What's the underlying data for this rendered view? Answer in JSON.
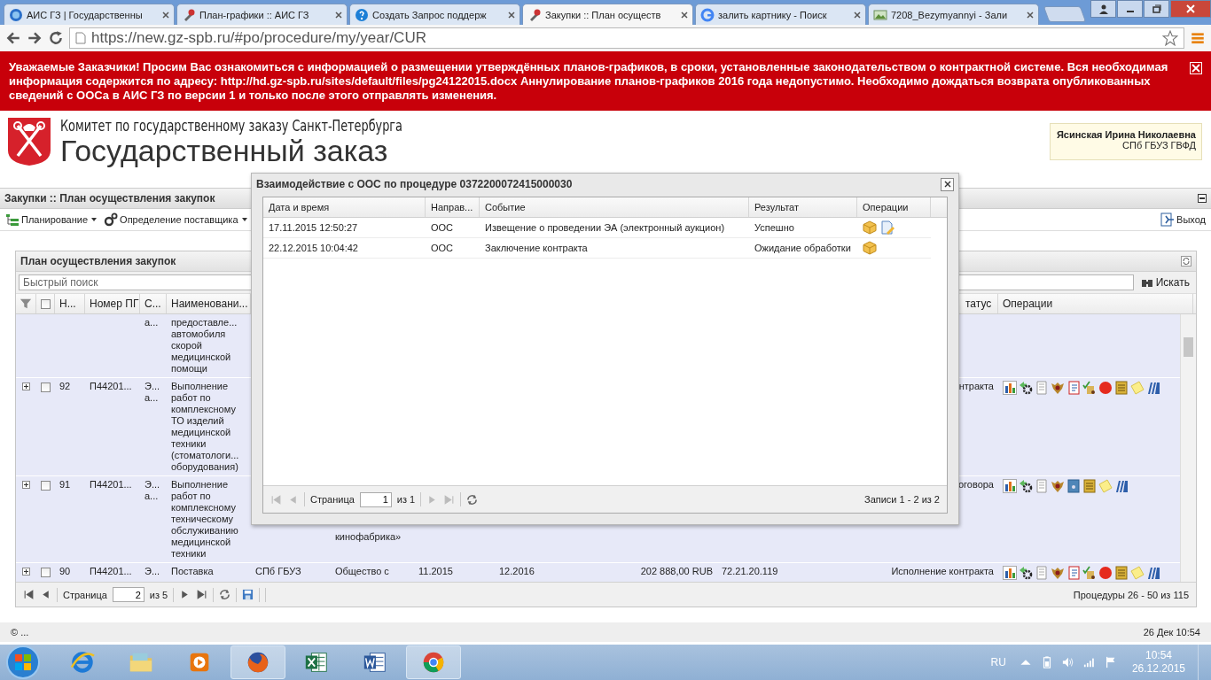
{
  "browser": {
    "tabs": [
      {
        "kind": "globe",
        "title": "АИС ГЗ | Государственны",
        "selected": false
      },
      {
        "kind": "wrench",
        "title": "План-графики :: АИС ГЗ",
        "selected": false
      },
      {
        "kind": "help",
        "title": "Создать Запрос поддерж",
        "selected": false
      },
      {
        "kind": "wrench",
        "title": "Закупки :: План осуществ",
        "selected": true
      },
      {
        "kind": "search",
        "title": "залить картнику - Поиск",
        "selected": false
      },
      {
        "kind": "image",
        "title": "7208_Bezymyannyi - Зали",
        "selected": false
      }
    ],
    "address": "https://new.gz-spb.ru/#po/procedure/my/year/CUR"
  },
  "banner": {
    "text": "Уважаемые Заказчики! Просим Вас ознакомиться с информацией о размещении утверждённых планов-графиков, в сроки, установленные законодательством о контрактной системе. Вся необходимая информация содержится по адресу: http://hd.gz-spb.ru/sites/default/files/pg24122015.docx Аннулирование планов-графиков 2016 года недопустимо. Необходимо дождаться возврата опубликованных сведений с ООСа в АИС ГЗ по версии 1 и только после этого отправлять изменения."
  },
  "header": {
    "org": "Комитет по государственному заказу Санкт-Петербурга",
    "title": "Государственный заказ",
    "user": {
      "name": "Ясинская Ирина Николаевна",
      "org": "СПб ГБУЗ ГВФД"
    }
  },
  "panel": {
    "title": "Закупки :: План осуществления закупок",
    "toolbar": [
      {
        "kind": "tree",
        "label": "Планирование"
      },
      {
        "kind": "gears",
        "label": "Определение поставщика"
      }
    ],
    "exit": "Выход"
  },
  "grid": {
    "title": "План осуществления закупок",
    "search": {
      "placeholder": "Быстрый поиск",
      "button": "Искать"
    },
    "select_all": {
      "checked": false
    },
    "columns": [
      "Н...",
      "Номер ПГ",
      "С...",
      "Наименовани...",
      "татус",
      "Операции"
    ],
    "rows": [
      {
        "method": "а...",
        "name": "предоставле... автомобиля скорой медицинской помощи"
      },
      {
        "checked": false,
        "n": "92",
        "pg": "П44201...",
        "method": "Э... а...",
        "name": "Выполнение работ по комплексному ТО изделий медицинской техники (стоматологи... оборудования)",
        "status": "нтракта",
        "operations": [
          {
            "kind": "chart"
          },
          {
            "kind": "gear"
          },
          {
            "kind": "page"
          },
          {
            "kind": "emblem"
          },
          {
            "kind": "notebook"
          },
          {
            "kind": "check"
          },
          {
            "kind": "record"
          },
          {
            "kind": "scroll"
          },
          {
            "kind": "note"
          },
          {
            "kind": "books"
          }
        ]
      },
      {
        "checked": false,
        "n": "91",
        "pg": "П44201...",
        "method": "Э... а...",
        "name": "Выполнение работ по комплексному техническому обслуживанию медицинской техники",
        "supplier": "кинофабрика»",
        "status": "оговора",
        "operations": [
          {
            "kind": "chart"
          },
          {
            "kind": "gear"
          },
          {
            "kind": "page"
          },
          {
            "kind": "emblem"
          },
          {
            "kind": "lock"
          },
          {
            "kind": "scroll"
          },
          {
            "kind": "note"
          },
          {
            "kind": "books"
          }
        ]
      },
      {
        "checked": false,
        "n": "90",
        "pg": "П44201...",
        "method": "Э...",
        "name": "Поставка",
        "customer": "СПб ГБУЗ",
        "supplier": "Общество с",
        "start": "11.2015",
        "end": "12.2016",
        "price": "202 888,00 RUB",
        "code": "72.21.20.119",
        "status": "Исполнение контракта",
        "operations": [
          {
            "kind": "chart"
          },
          {
            "kind": "gear"
          },
          {
            "kind": "page"
          },
          {
            "kind": "emblem"
          },
          {
            "kind": "notebook"
          },
          {
            "kind": "check"
          },
          {
            "kind": "record"
          },
          {
            "kind": "scroll"
          },
          {
            "kind": "note"
          },
          {
            "kind": "books"
          }
        ]
      }
    ],
    "pager": {
      "page_label": "Страница",
      "page": "2",
      "of": "из 5",
      "summary": "Процедуры 26 - 50 из 115"
    }
  },
  "dialog": {
    "title": "Взаимодействие с ООС по процедуре 0372200072415000030",
    "columns": [
      "Дата и время",
      "Направ...",
      "Событие",
      "Результат",
      "Операции"
    ],
    "rows": [
      {
        "date": "17.11.2015 12:50:27",
        "direction": "ООС",
        "event": "Извещение о проведении ЭА (электронный аукцион)",
        "result": "Успешно",
        "operations": [
          {
            "kind": "box"
          },
          {
            "kind": "edit"
          }
        ]
      },
      {
        "date": "22.12.2015 10:04:42",
        "direction": "ООС",
        "event": "Заключение контракта",
        "result": "Ожидание обработки",
        "operations": [
          {
            "kind": "box"
          }
        ]
      }
    ],
    "pager": {
      "page_label": "Страница",
      "page": "1",
      "of": "из 1",
      "summary": "Записи 1 - 2 из 2"
    }
  },
  "footer": {
    "copyright": "© ...",
    "datetime": "26 Дек 10:54"
  },
  "taskbar": {
    "apps": [
      {
        "kind": "ie",
        "active": false
      },
      {
        "kind": "folder",
        "active": false
      },
      {
        "kind": "media",
        "active": false
      },
      {
        "kind": "firefox",
        "active": true
      },
      {
        "kind": "excel",
        "active": false
      },
      {
        "kind": "word",
        "active": false
      },
      {
        "kind": "chrome",
        "active": true
      }
    ],
    "lang": "RU",
    "time": "10:54",
    "date": "26.12.2015"
  }
}
